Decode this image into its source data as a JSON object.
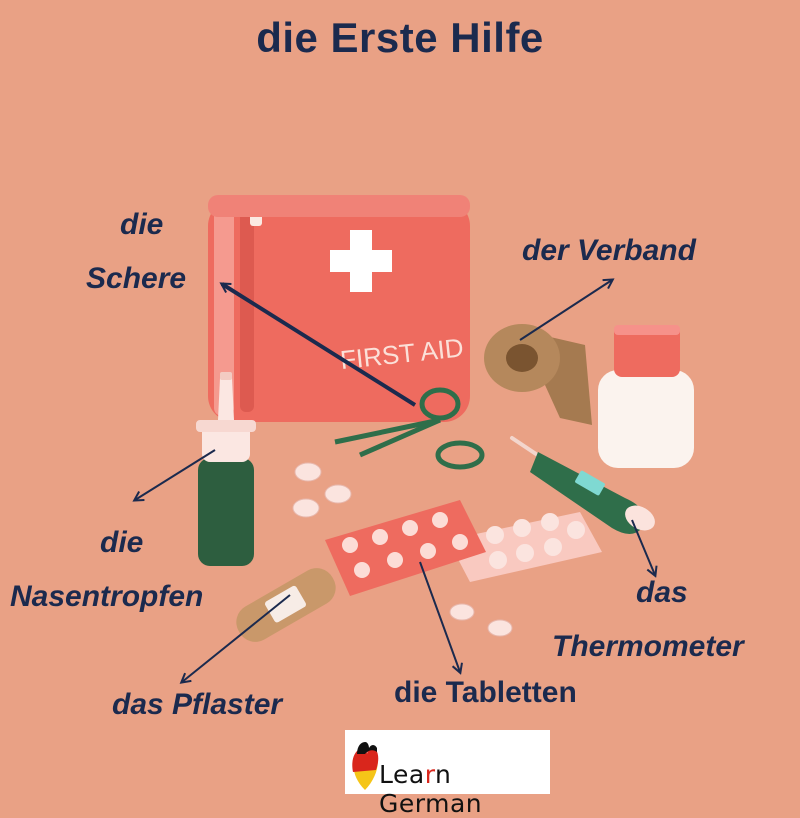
{
  "title": "die Erste Hilfe",
  "kit_text": "FIRST AID",
  "labels": {
    "schere_1": "die",
    "schere_2": "Schere",
    "verband": "der Verband",
    "nasentropfen_1": "die",
    "nasentropfen_2": "Nasentropfen",
    "thermometer_1": "das",
    "thermometer_2": "Thermometer",
    "pflaster": "das Pflaster",
    "tabletten": "die Tabletten"
  },
  "logo": {
    "text_a": "Lea",
    "text_r": "r",
    "text_b": "n German"
  },
  "colors": {
    "background": "#e9a185",
    "text": "#1b2a4e",
    "kit": "#ee6b5f",
    "bottle": "#2d5e3f",
    "tape": "#b5885c",
    "thermometer": "#2f6e4a"
  },
  "icons": [
    "first-aid-kit-icon",
    "scissors-icon",
    "tape-roll-icon",
    "pill-bottle-icon",
    "nasal-spray-icon",
    "thermometer-icon",
    "blister-pack-icon",
    "bandage-icon",
    "pill-icon",
    "flag-heart-icon"
  ]
}
